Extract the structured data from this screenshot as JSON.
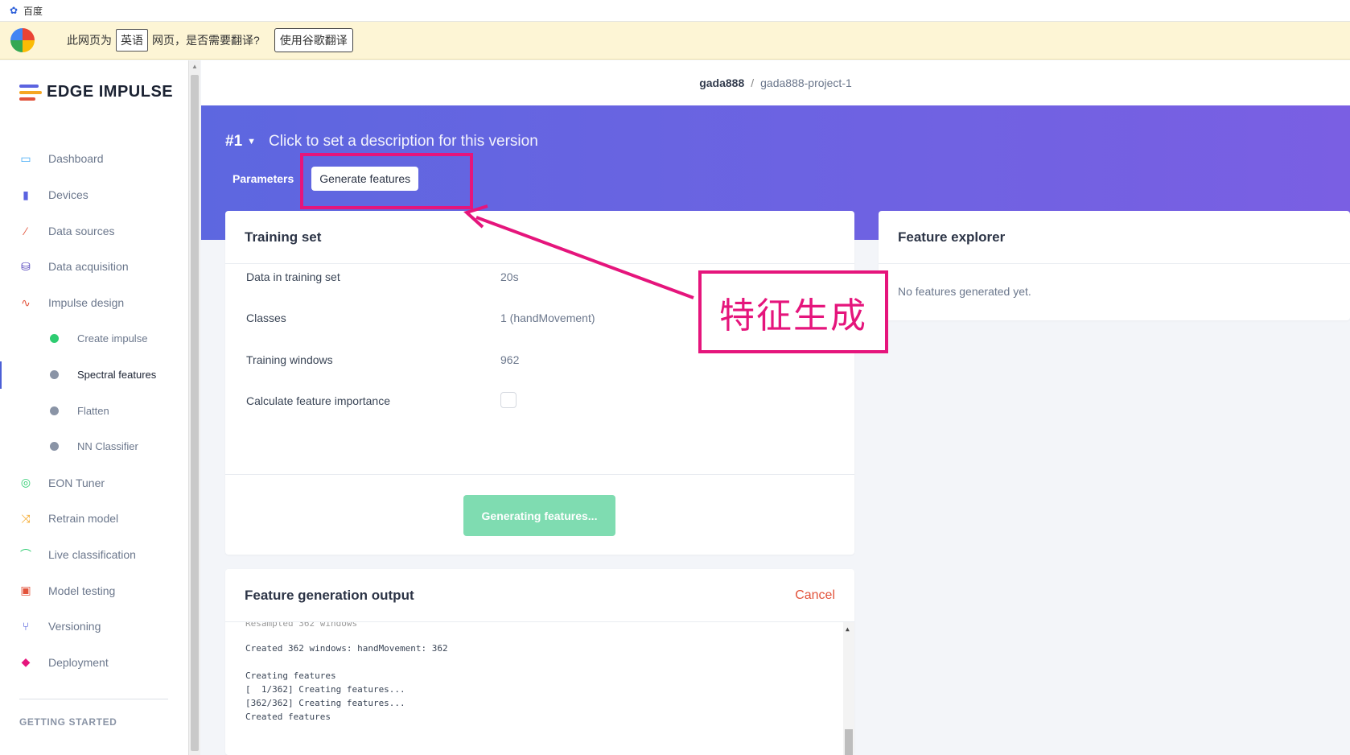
{
  "browser": {
    "tab_title": "百度",
    "translate_prefix": "此网页为",
    "translate_lang": "英语",
    "translate_suffix": "网页，是否需要翻译?",
    "translate_button": "使用谷歌翻译"
  },
  "brand": {
    "name": "EDGE IMPULSE"
  },
  "nav": {
    "items": [
      {
        "label": "Dashboard",
        "icon": "monitor-icon",
        "color": "#3fa9f5"
      },
      {
        "label": "Devices",
        "icon": "chip-icon",
        "color": "#5b63e0"
      },
      {
        "label": "Data sources",
        "icon": "magic-wand-icon",
        "color": "#e2533b"
      },
      {
        "label": "Data acquisition",
        "icon": "database-icon",
        "color": "#4b3bb8"
      },
      {
        "label": "Impulse design",
        "icon": "pulse-icon",
        "color": "#e2533b"
      }
    ],
    "subitems": [
      {
        "label": "Create impulse",
        "dot_color": "#2ecc71"
      },
      {
        "label": "Spectral features",
        "dot_color": "#8a94a6"
      },
      {
        "label": "Flatten",
        "dot_color": "#8a94a6"
      },
      {
        "label": "NN Classifier",
        "dot_color": "#8a94a6"
      }
    ],
    "items2": [
      {
        "label": "EON Tuner",
        "icon": "compass-icon",
        "color": "#2ecc71"
      },
      {
        "label": "Retrain model",
        "icon": "shuffle-icon",
        "color": "#f5a623"
      },
      {
        "label": "Live classification",
        "icon": "antenna-icon",
        "color": "#2ecc71"
      },
      {
        "label": "Model testing",
        "icon": "clipboard-check-icon",
        "color": "#e2533b"
      },
      {
        "label": "Versioning",
        "icon": "branch-icon",
        "color": "#3b4bd6"
      },
      {
        "label": "Deployment",
        "icon": "cube-icon",
        "color": "#e5157c"
      }
    ],
    "section_getting_started": "GETTING STARTED"
  },
  "topbar": {
    "user": "gada888",
    "separator": "/",
    "project": "gada888-project-1"
  },
  "version": {
    "number": "#1",
    "description": "Click to set a description for this version",
    "tab_parameters": "Parameters",
    "tab_generate": "Generate features"
  },
  "training_set": {
    "title": "Training set",
    "rows": [
      {
        "label": "Data in training set",
        "value": "20s"
      },
      {
        "label": "Classes",
        "value": "1 (handMovement)"
      },
      {
        "label": "Training windows",
        "value": "962"
      },
      {
        "label": "Calculate feature importance",
        "value": ""
      }
    ],
    "button": "Generating features..."
  },
  "feature_explorer": {
    "title": "Feature explorer",
    "empty_text": "No features generated yet."
  },
  "output": {
    "title": "Feature generation output",
    "cancel": "Cancel",
    "lines": [
      "Created 362 windows: handMovement: 362",
      "",
      "Creating features",
      "[  1/362] Creating features...",
      "[362/362] Creating features...",
      "Created features"
    ]
  },
  "annotation": {
    "callout_text": "特征生成",
    "color": "#e5157c"
  }
}
